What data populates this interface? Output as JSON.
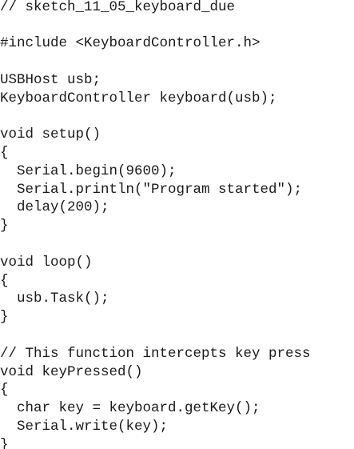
{
  "code": {
    "lines": [
      "// sketch_11_05_keyboard_due",
      "",
      "#include <KeyboardController.h>",
      "",
      "USBHost usb;",
      "KeyboardController keyboard(usb);",
      "",
      "void setup()",
      "{",
      "  Serial.begin(9600);",
      "  Serial.println(\"Program started\");",
      "  delay(200);",
      "}",
      "",
      "void loop()",
      "{",
      "  usb.Task();",
      "}",
      "",
      "// This function intercepts key press",
      "void keyPressed()",
      "{",
      "  char key = keyboard.getKey();",
      "  Serial.write(key);",
      "}"
    ]
  }
}
